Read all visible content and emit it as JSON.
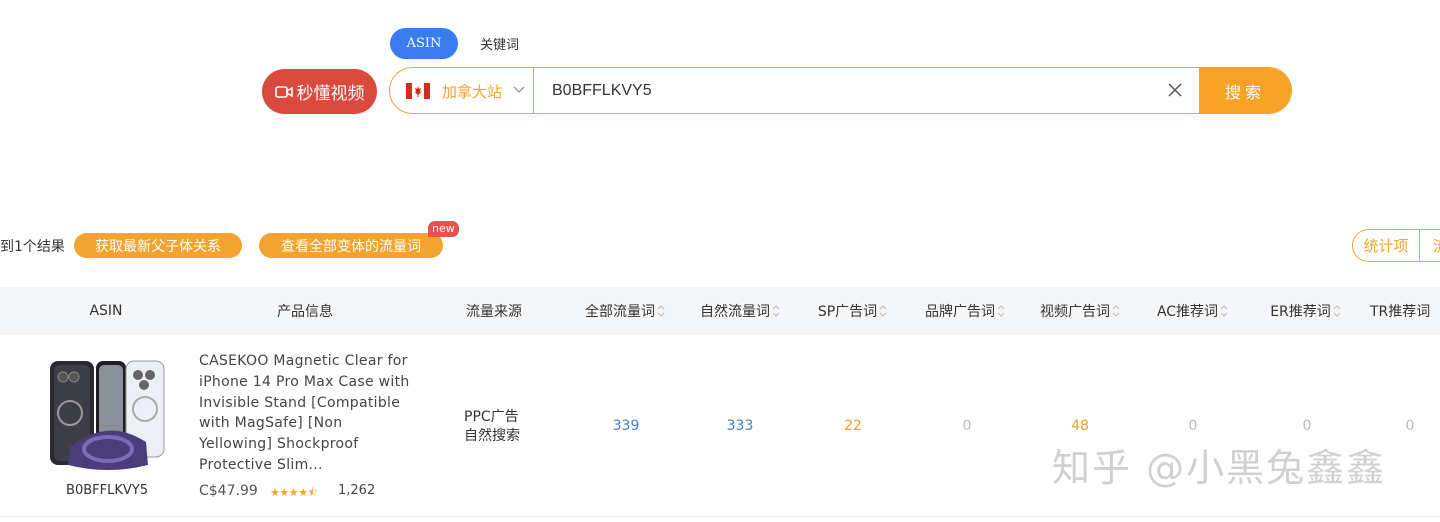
{
  "search": {
    "tabs": [
      "ASIN",
      "关键词"
    ],
    "video_button": "秒懂视频",
    "site": "加拿大站",
    "query": "B0BFFLKVY5",
    "button": "搜索"
  },
  "results": {
    "count_text": "到1个结果",
    "action1": "获取最新父子体关系",
    "action2": "查看全部变体的流量词",
    "new_badge": "new",
    "stats_button": "统计项",
    "stats_button2": "流"
  },
  "table": {
    "headers": [
      "ASIN",
      "产品信息",
      "流量来源",
      "全部流量词",
      "自然流量词",
      "SP广告词",
      "品牌广告词",
      "视频广告词",
      "AC推荐词",
      "ER推荐词",
      "TR推荐词"
    ],
    "row": {
      "asin": "B0BFFLKVY5",
      "title": "CASEKOO Magnetic Clear for iPhone 14 Pro Max Case with Invisible Stand [Compatible with MagSafe] [Non Yellowing] Shockproof Protective Slim...",
      "price": "C$47.99",
      "stars": 4.5,
      "rating_count": "1,262",
      "source1": "PPC广告",
      "source2": "自然搜索",
      "all_words": "339",
      "organic_words": "333",
      "sp_words": "22",
      "brand_words": "0",
      "video_words": "48",
      "ac_words": "0",
      "er_words": "0",
      "tr_words": "0"
    }
  },
  "watermark": "知乎 @小黑兔鑫鑫",
  "colors": {
    "accent": "#f5a227",
    "primary_blue": "#3a7cf0",
    "video_red": "#d9493e"
  }
}
